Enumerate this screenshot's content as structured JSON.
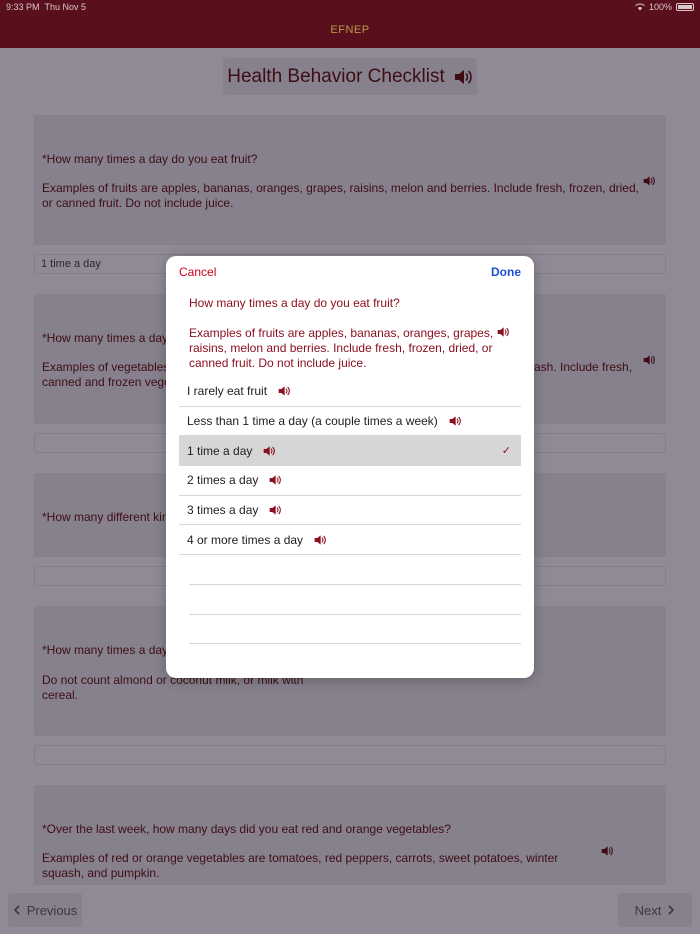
{
  "status": {
    "time": "9:33 PM",
    "date": "Thu Nov 5",
    "battery": "100%"
  },
  "nav": {
    "title": "EFNEP"
  },
  "page": {
    "title": "Health Behavior Checklist"
  },
  "cards": [
    {
      "question": "*How many times a day do you eat fruit?",
      "example": "Examples of fruits are apples, bananas, oranges, grapes, raisins, melon and berries. Include fresh, frozen, dried, or canned fruit. Do not include juice.",
      "answer": "1 time a day"
    },
    {
      "question": "*How many times a day",
      "example_left": "Examples of vegetables",
      "example_left2": "canned and frozen vege",
      "example_right": "ash. Include fresh,",
      "answer": ""
    },
    {
      "question": "*How many different kin",
      "answer": ""
    },
    {
      "question": "*How many times a day",
      "example": "Do not count almond or coconut milk, or milk with cereal.",
      "answer": ""
    },
    {
      "question": "*Over the last week, how many days did you eat red and orange vegetables?",
      "example": "Examples of red or orange vegetables are tomatoes, red peppers, carrots, sweet potatoes, winter squash, and pumpkin."
    }
  ],
  "footer": {
    "previous": "Previous",
    "next": "Next"
  },
  "modal": {
    "cancel": "Cancel",
    "done": "Done",
    "question": "How many times a day do you eat fruit?",
    "example": "Examples of fruits are apples, bananas, oranges, grapes, raisins, melon and berries. Include fresh, frozen, dried, or canned fruit. Do not include juice.",
    "options": [
      "I rarely eat fruit",
      "Less than 1 time a day (a couple times a week)",
      "1 time a day",
      "2 times a day",
      "3 times a day",
      "4 or more times a day"
    ],
    "selected_option": "1 time a day"
  },
  "colors": {
    "brand": "#5a0f1d",
    "accent_red": "#8b1020",
    "done_blue": "#1d4fd8",
    "cancel_red": "#d0021b"
  },
  "icons": [
    "speaker-icon",
    "chevron-left-icon",
    "chevron-right-icon",
    "checkmark-icon",
    "wifi-icon",
    "battery-icon"
  ]
}
